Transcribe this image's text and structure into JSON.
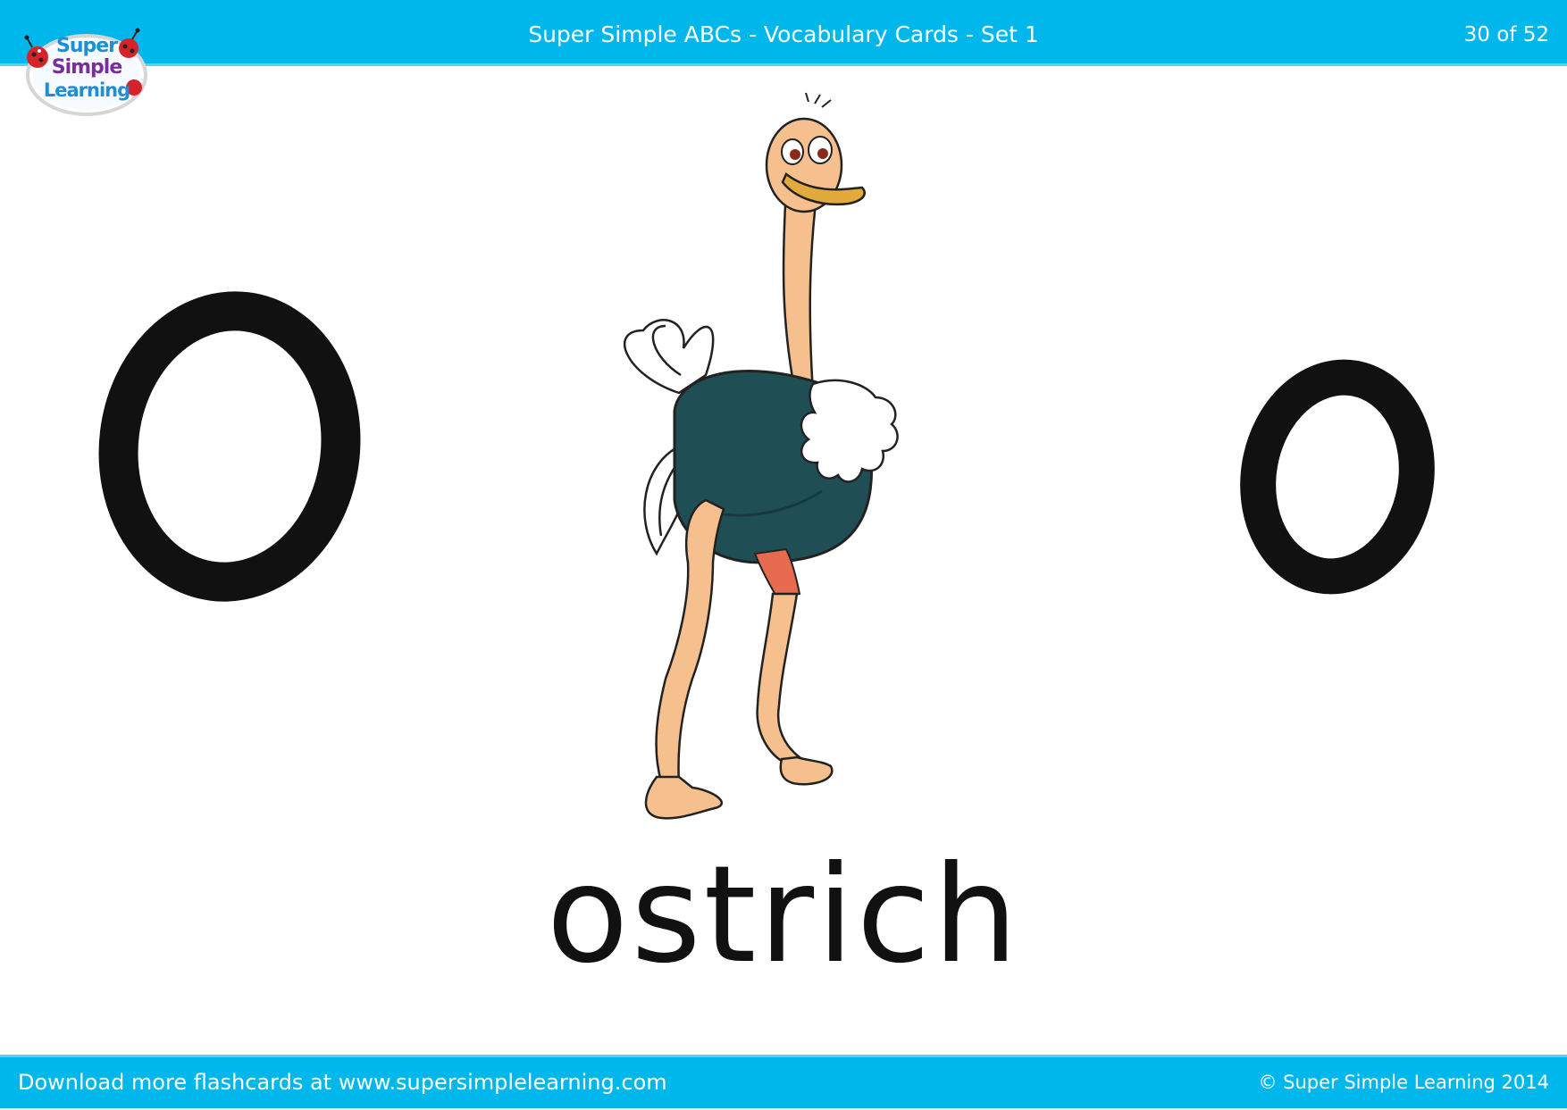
{
  "header": {
    "title": "Super Simple ABCs - Vocabulary Cards - Set 1",
    "page_counter": "30 of 52"
  },
  "logo": {
    "line1": "Super",
    "line2": "Simple",
    "line3": "Learning"
  },
  "card": {
    "uppercase_letter": "O",
    "lowercase_letter": "o",
    "word": "ostrich",
    "illustration": "ostrich"
  },
  "footer": {
    "download_text": "Download more flashcards at www.supersimplelearning.com",
    "copyright": "© Super Simple Learning 2014"
  },
  "colors": {
    "bar": "#00b7ec",
    "letter": "#111111",
    "ostrich_body": "#1f4f55",
    "ostrich_skin": "#f5c08e"
  }
}
